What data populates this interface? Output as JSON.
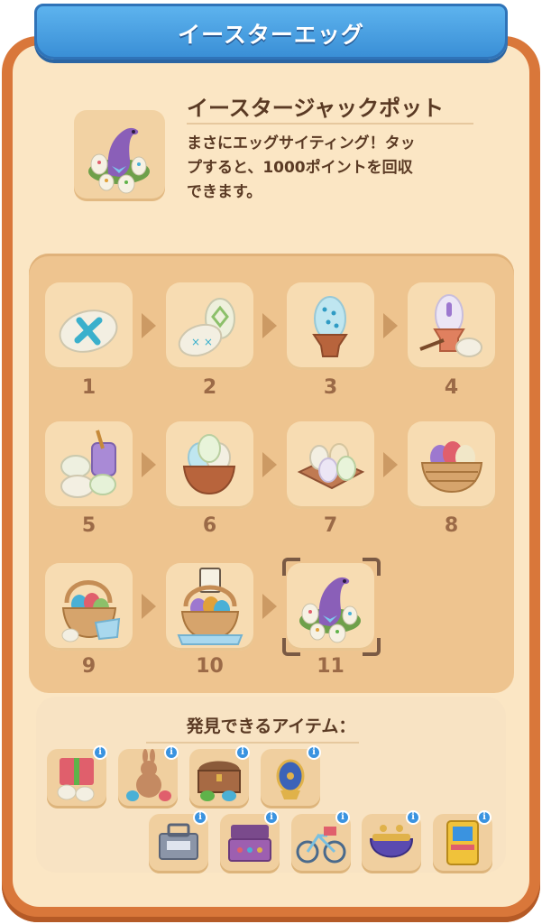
{
  "header": {
    "title": "イースターエッグ"
  },
  "jackpot": {
    "title": "イースタージャックポット",
    "description": "まさにエッグサイティング！タップすると、1000ポイントを回収できます。",
    "desc_line1": "まさにエッグサイティング！タッ",
    "desc_line2": "プすると、1000ポイントを回収",
    "desc_line3": "できます。"
  },
  "chain": {
    "steps": [
      {
        "label": "1",
        "icon": "blue-cross-egg-icon"
      },
      {
        "label": "2",
        "icon": "two-decorated-eggs-icon"
      },
      {
        "label": "3",
        "icon": "egg-in-cup-icon"
      },
      {
        "label": "4",
        "icon": "egg-cup-with-brush-icon"
      },
      {
        "label": "5",
        "icon": "paint-jar-eggs-icon"
      },
      {
        "label": "6",
        "icon": "bowl-of-eggs-icon"
      },
      {
        "label": "7",
        "icon": "egg-tray-icon"
      },
      {
        "label": "8",
        "icon": "egg-basket-icon"
      },
      {
        "label": "9",
        "icon": "tall-egg-basket-icon"
      },
      {
        "label": "10",
        "icon": "decorated-basket-icon"
      },
      {
        "label": "11",
        "icon": "easter-jackpot-dino-icon"
      }
    ],
    "selected": "11"
  },
  "discover": {
    "title": "発見できるアイテム：",
    "info_glyph": "i",
    "items": [
      {
        "icon": "gift-box-eggs-icon"
      },
      {
        "icon": "bunny-with-eggs-icon"
      },
      {
        "icon": "treasure-chest-icon"
      },
      {
        "icon": "jeweled-egg-icon"
      },
      {
        "icon": "toolbox-icon"
      },
      {
        "icon": "jewelry-box-icon"
      },
      {
        "icon": "bicycle-icon"
      },
      {
        "icon": "coin-purse-icon"
      },
      {
        "icon": "arcade-machine-icon"
      }
    ]
  },
  "colors": {
    "frame": "#d9773a",
    "banner": "#3a8fd6",
    "panel": "#fbe6c4",
    "text": "#5a3a24",
    "step_number": "#9b6a47",
    "info_badge": "#3a93e0"
  }
}
